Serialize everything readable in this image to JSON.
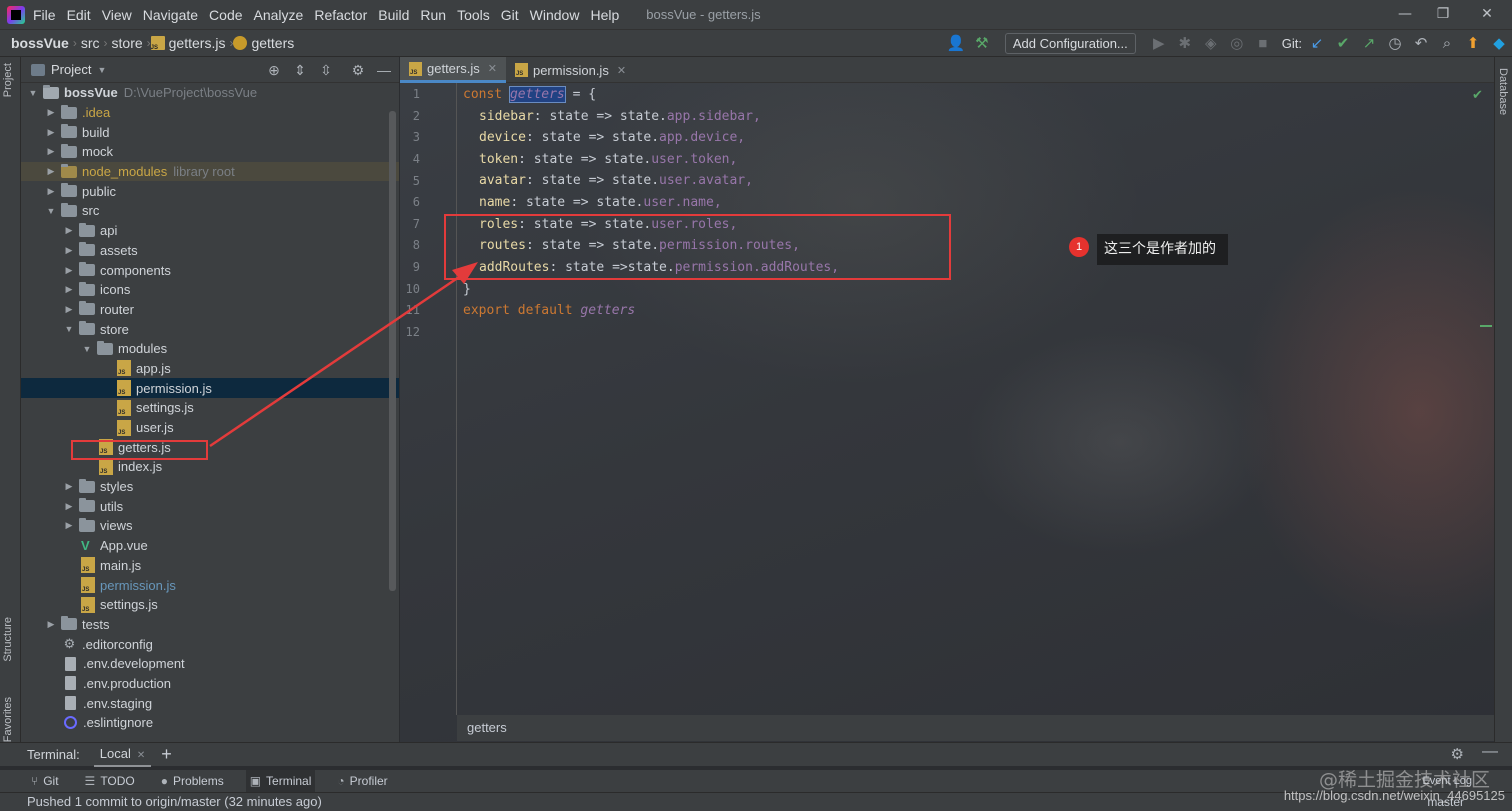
{
  "menubar": {
    "items": [
      "File",
      "Edit",
      "View",
      "Navigate",
      "Code",
      "Analyze",
      "Refactor",
      "Build",
      "Run",
      "Tools",
      "Git",
      "Window",
      "Help"
    ],
    "window_title": "bossVue - getters.js"
  },
  "navbar": {
    "project": "bossVue",
    "crumbs": [
      "src",
      "store",
      "getters.js",
      "getters"
    ],
    "add_configuration": "Add Configuration...",
    "git_label": "Git:"
  },
  "left_strip": {
    "project_tab": "Project",
    "structure_tab": "Structure",
    "favorites_tab": "Favorites"
  },
  "project_panel": {
    "title": "Project",
    "root_name": "bossVue",
    "root_path": "D:\\VueProject\\bossVue",
    "tree": {
      "idea": ".idea",
      "build": "build",
      "mock": "mock",
      "node_modules": "node_modules",
      "node_modules_hint": "library root",
      "public": "public",
      "src": "src",
      "api": "api",
      "assets": "assets",
      "components": "components",
      "icons": "icons",
      "router": "router",
      "store": "store",
      "modules": "modules",
      "app_js": "app.js",
      "permission_js_mod": "permission.js",
      "settings_js_mod": "settings.js",
      "user_js": "user.js",
      "getters_js": "getters.js",
      "index_js": "index.js",
      "styles": "styles",
      "utils": "utils",
      "views": "views",
      "app_vue": "App.vue",
      "main_js": "main.js",
      "permission_js": "permission.js",
      "settings_js": "settings.js",
      "tests": "tests",
      "editorconfig": ".editorconfig",
      "env_development": ".env.development",
      "env_production": ".env.production",
      "env_staging": ".env.staging",
      "eslintignore": ".eslintignore"
    }
  },
  "editor": {
    "tabs": [
      {
        "label": "getters.js",
        "active": true
      },
      {
        "label": "permission.js",
        "active": false
      }
    ],
    "line_numbers": [
      "1",
      "2",
      "3",
      "4",
      "5",
      "6",
      "7",
      "8",
      "9",
      "10",
      "11",
      "12"
    ],
    "code": {
      "l1_kw": "const",
      "l1_name": "getters",
      "l1_rest": " = {",
      "l2_prop": "sidebar",
      "l2_rest": ": state => state.",
      "l2_obj": "app.sidebar,",
      "l3_prop": "device",
      "l3_rest": ": state => state.",
      "l3_obj": "app.device,",
      "l4_prop": "token",
      "l4_rest": ": state => state.",
      "l4_obj": "user.token,",
      "l5_prop": "avatar",
      "l5_rest": ": state => state.",
      "l5_obj": "user.avatar,",
      "l6_prop": "name",
      "l6_rest": ": state => state.",
      "l6_obj": "user.name,",
      "l7_prop": "roles",
      "l7_rest": ": state => state.",
      "l7_obj": "user.roles,",
      "l8_prop": "routes",
      "l8_rest": ": state => state.",
      "l8_obj": "permission.routes,",
      "l9_prop": "addRoutes",
      "l9_rest": ": state =>state.",
      "l9_obj": "permission.addRoutes,",
      "l10": "}",
      "l11_kw": "export default",
      "l11_name": "getters"
    },
    "breadcrumb": "getters",
    "right_tab": "Database"
  },
  "annotation": {
    "badge": "1",
    "text": "这三个是作者加的"
  },
  "terminal": {
    "label": "Terminal:",
    "tab": "Local",
    "add": "+"
  },
  "toolwindows": [
    {
      "label": "Git",
      "icon": "git-icon"
    },
    {
      "label": "TODO",
      "icon": "todo-icon"
    },
    {
      "label": "Problems",
      "icon": "problems-icon"
    },
    {
      "label": "Terminal",
      "icon": "terminal-icon"
    },
    {
      "label": "Profiler",
      "icon": "profiler-icon"
    }
  ],
  "status": {
    "message": "Pushed 1 commit to origin/master (32 minutes ago)",
    "event_log": "Event Log",
    "branch": "master"
  },
  "watermark": {
    "line1": "@稀土掘金技术社区",
    "line2": "https://blog.csdn.net/weixin_44695125"
  },
  "colors": {
    "annotation_red": "#e33b3b",
    "selection_blue": "#0d293e",
    "keyword": "#cc7832"
  }
}
